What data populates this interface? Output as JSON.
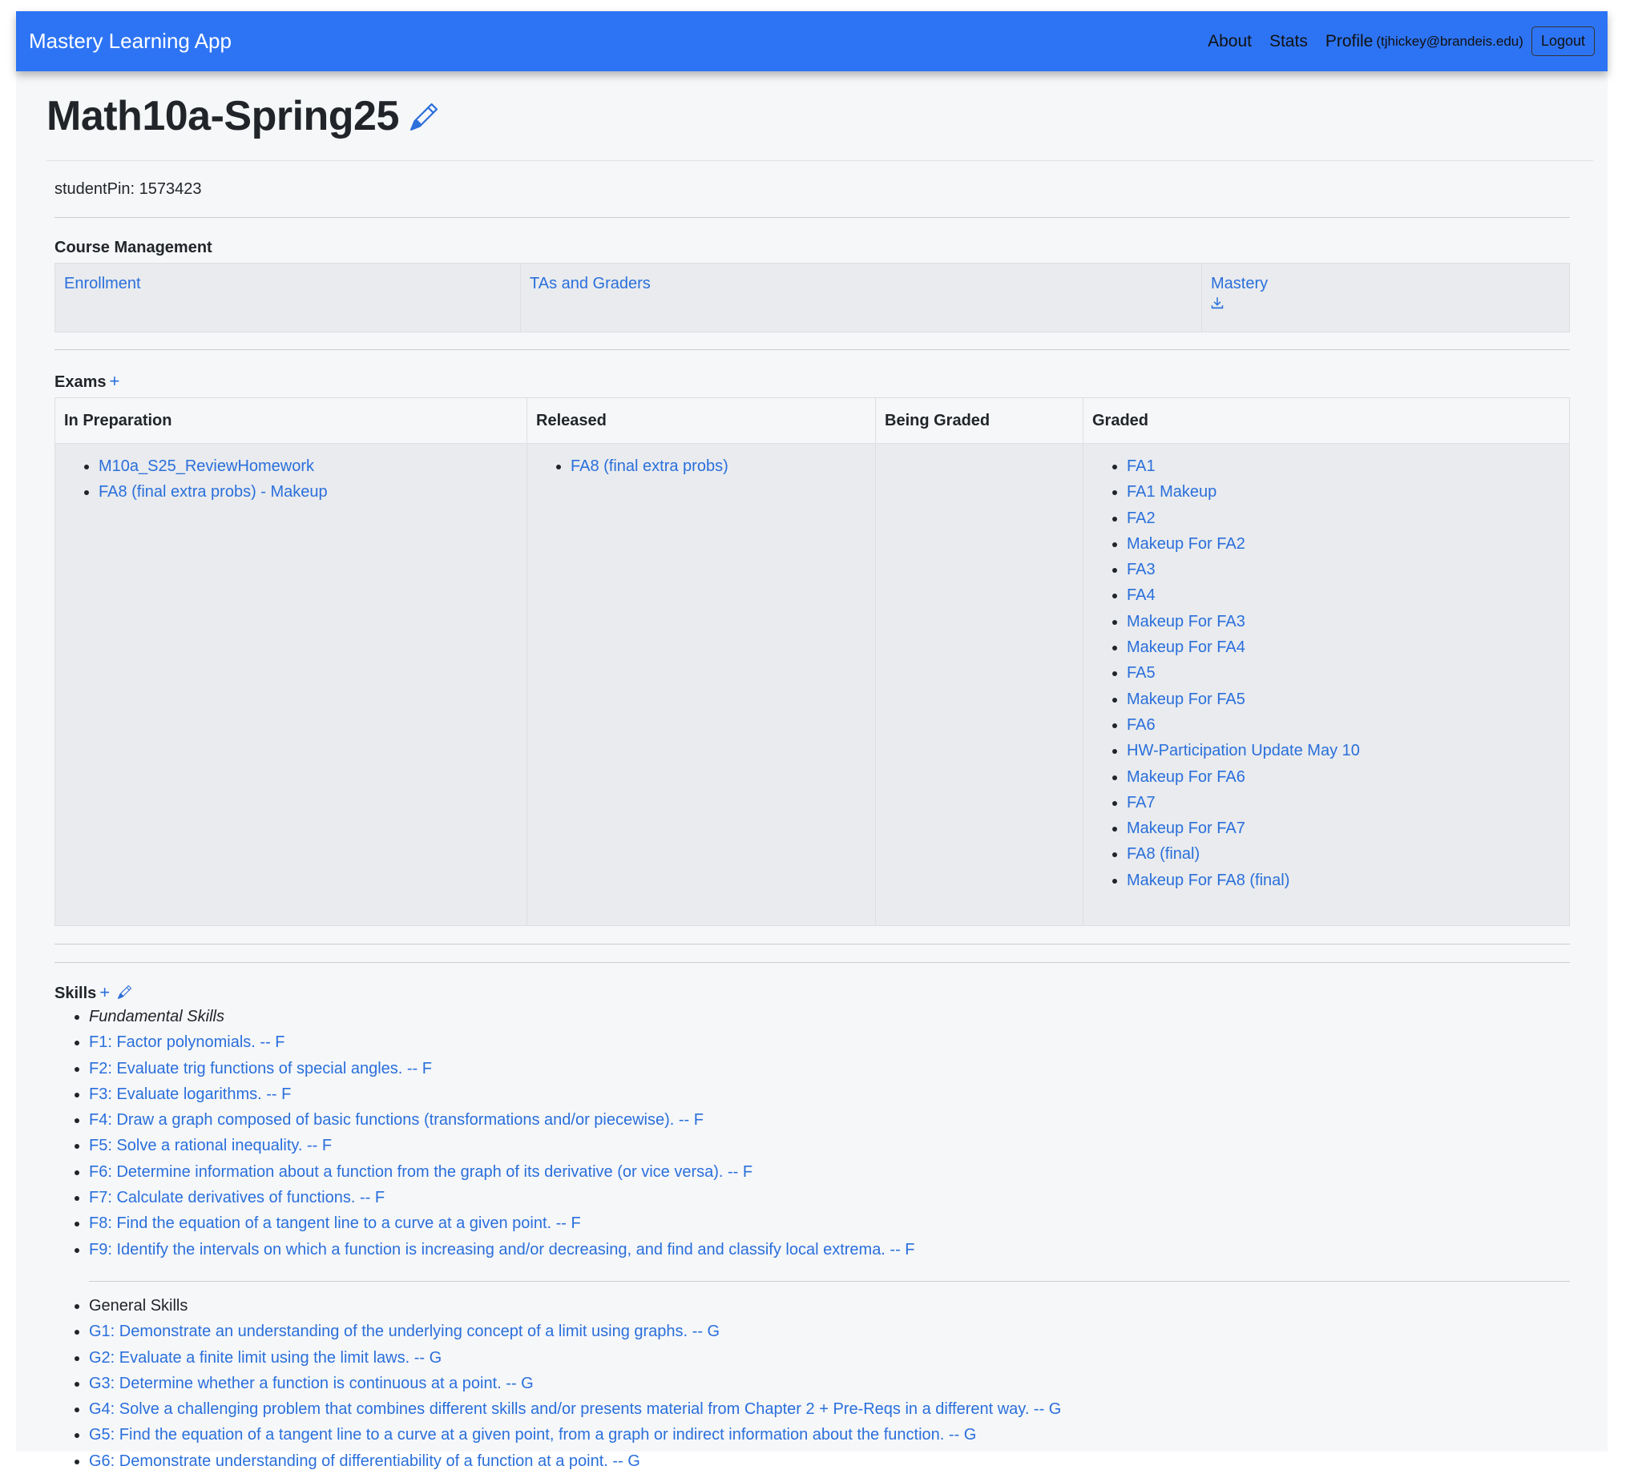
{
  "navbar": {
    "brand": "Mastery Learning App",
    "about": "About",
    "stats": "Stats",
    "profile": "Profile",
    "email": "(tjhickey@brandeis.edu)",
    "logout": "Logout"
  },
  "course": {
    "title": "Math10a-Spring25",
    "pin_label": "studentPin: 1573423"
  },
  "course_management": {
    "title": "Course Management",
    "enrollment": "Enrollment",
    "tas": "TAs and Graders",
    "mastery": "Mastery"
  },
  "exams": {
    "title": "Exams",
    "add": "+",
    "columns": [
      "In Preparation",
      "Released",
      "Being Graded",
      "Graded"
    ],
    "in_preparation": [
      "M10a_S25_ReviewHomework",
      "FA8 (final extra probs) - Makeup"
    ],
    "released": [
      "FA8 (final extra probs)"
    ],
    "graded": [
      "FA1",
      "FA1 Makeup",
      "FA2",
      "Makeup For FA2",
      "FA3",
      "FA4",
      "Makeup For FA3",
      "Makeup For FA4",
      "FA5",
      "Makeup For FA5",
      "FA6",
      "HW-Participation Update May 10",
      "Makeup For FA6",
      "FA7",
      "Makeup For FA7",
      "FA8 (final)",
      "Makeup For FA8 (final)"
    ]
  },
  "skills": {
    "title": "Skills",
    "add": "+",
    "fundamental_header": "Fundamental Skills",
    "fundamental": [
      "F1: Factor polynomials. -- F",
      "F2: Evaluate trig functions of special angles. -- F",
      "F3: Evaluate logarithms. -- F",
      "F4: Draw a graph composed of basic functions (transformations and/or piecewise). -- F",
      "F5: Solve a rational inequality. -- F",
      "F6: Determine information about a function from the graph of its derivative (or vice versa). -- F",
      "F7: Calculate derivatives of functions. -- F",
      "F8: Find the equation of a tangent line to a curve at a given point. -- F",
      "F9: Identify the intervals on which a function is increasing and/or decreasing, and find and classify local extrema. -- F"
    ],
    "general_header": "General Skills",
    "general": [
      "G1: Demonstrate an understanding of the underlying concept of a limit using graphs. -- G",
      "G2: Evaluate a finite limit using the limit laws. -- G",
      "G3: Determine whether a function is continuous at a point. -- G",
      "G4: Solve a challenging problem that combines different skills and/or presents material from Chapter 2 + Pre-Reqs in a different way. -- G",
      "G5: Find the equation of a tangent line to a curve at a given point, from a graph or indirect information about the function. -- G",
      "G6: Demonstrate understanding of differentiability of a function at a point. -- G"
    ]
  },
  "colors": {
    "navbar": "#2d74f4",
    "link": "#2a6fdb",
    "page_bg": "#f6f7f9",
    "cell_bg": "#e9ebee"
  },
  "icons": {
    "edit_title": "pencil-icon",
    "mastery_download": "download-icon",
    "skills_edit": "pencil-icon"
  }
}
